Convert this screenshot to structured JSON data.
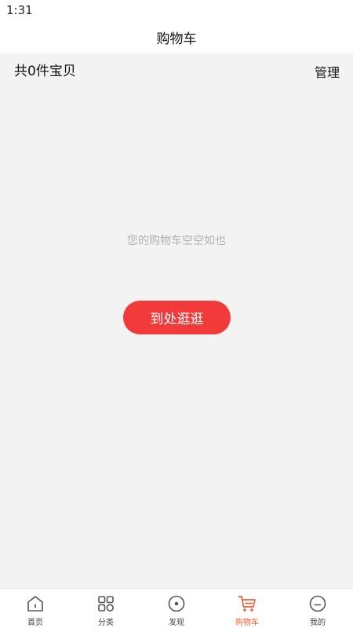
{
  "status_bar": {
    "time": "1:31"
  },
  "header": {
    "title": "购物车"
  },
  "cart": {
    "item_count_label": "共0件宝贝",
    "manage_label": "管理",
    "empty_message": "您的购物车空空如也",
    "browse_button_label": "到处逛逛"
  },
  "tabbar": {
    "items": [
      {
        "label": "首页",
        "icon": "home-icon"
      },
      {
        "label": "分类",
        "icon": "grid-icon"
      },
      {
        "label": "发现",
        "icon": "discover-icon"
      },
      {
        "label": "购物车",
        "icon": "cart-icon",
        "active": true
      },
      {
        "label": "我的",
        "icon": "profile-icon"
      }
    ]
  },
  "colors": {
    "accent": "#f23a3a",
    "active_tab": "#f25a3a",
    "background": "#f3f3f3"
  }
}
